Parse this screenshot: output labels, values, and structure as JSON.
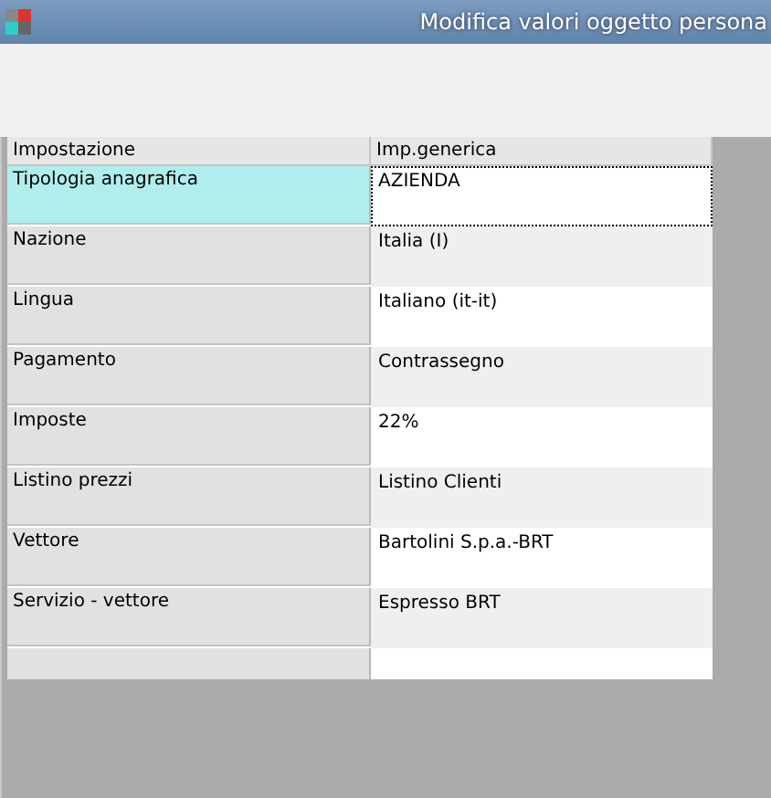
{
  "window": {
    "title": "Modifica valori oggetto persona"
  },
  "table": {
    "columns": [
      "Impostazione",
      "Imp.generica"
    ],
    "rows": [
      {
        "setting": "Tipologia anagrafica",
        "value": "AZIENDA",
        "selected": true
      },
      {
        "setting": "Nazione",
        "value": "Italia (I)",
        "selected": false
      },
      {
        "setting": "Lingua",
        "value": "Italiano (it-it)",
        "selected": false
      },
      {
        "setting": "Pagamento",
        "value": "Contrassegno",
        "selected": false
      },
      {
        "setting": "Imposte",
        "value": "22%",
        "selected": false
      },
      {
        "setting": "Listino prezzi",
        "value": "Listino Clienti",
        "selected": false
      },
      {
        "setting": "Vettore",
        "value": "Bartolini S.p.a.-BRT",
        "selected": false
      },
      {
        "setting": "Servizio - vettore",
        "value": "Espresso BRT",
        "selected": false
      }
    ]
  }
}
